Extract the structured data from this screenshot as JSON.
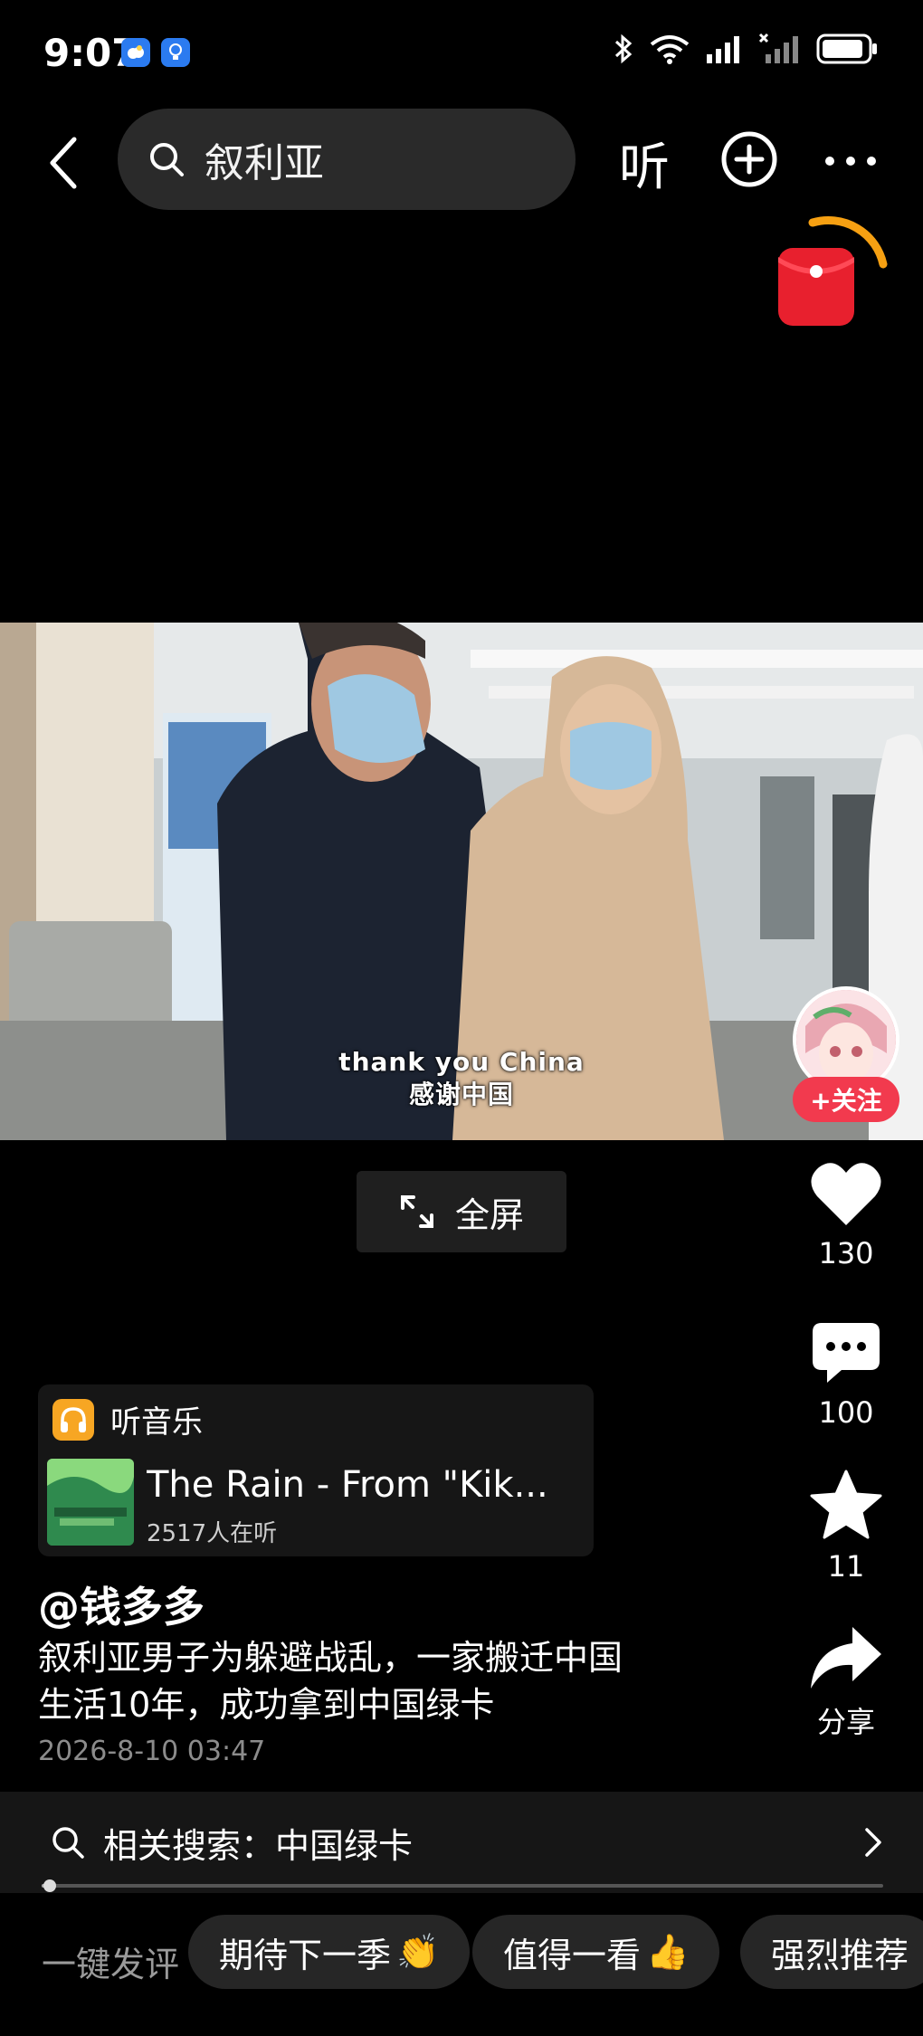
{
  "status_bar": {
    "time": "9:07",
    "app_icons": [
      "weather-app-icon",
      "bulb-app-icon"
    ],
    "right_icons": [
      "bluetooth-icon",
      "wifi-icon",
      "signal-icon",
      "signal-no-service-icon",
      "battery-icon"
    ]
  },
  "top_nav": {
    "search_query": "叙利亚",
    "listen_label": "听"
  },
  "video": {
    "subtitle_line1": "thank you China",
    "subtitle_line2": "感谢中国"
  },
  "fullscreen": {
    "label": "全屏"
  },
  "right_rail": {
    "follow_label": "+关注",
    "likes": "130",
    "comments": "100",
    "favorites": "11",
    "share_label": "分享"
  },
  "music": {
    "tag_label": "听音乐",
    "title": "The Rain - From \"Kik...",
    "listeners": "2517人在听"
  },
  "post": {
    "author": "@钱多多",
    "description_line1": "叙利亚男子为躲避战乱，一家搬迁中国",
    "description_line2": "生活10年，成功拿到中国绿卡",
    "date": "2026-8-10 03:47"
  },
  "related_search": {
    "label": "相关搜索：中国绿卡"
  },
  "playback": {
    "progress": 0.01
  },
  "quick_comment": {
    "label": "一键发评",
    "chips": [
      {
        "text": "期待下一季",
        "emoji": "👏"
      },
      {
        "text": "值得一看",
        "emoji": "👍"
      },
      {
        "text": "强烈推荐",
        "emoji": ""
      }
    ]
  },
  "colors": {
    "accent_red": "#f23a4e",
    "music_tag": "#f7a623",
    "background": "#000000"
  }
}
